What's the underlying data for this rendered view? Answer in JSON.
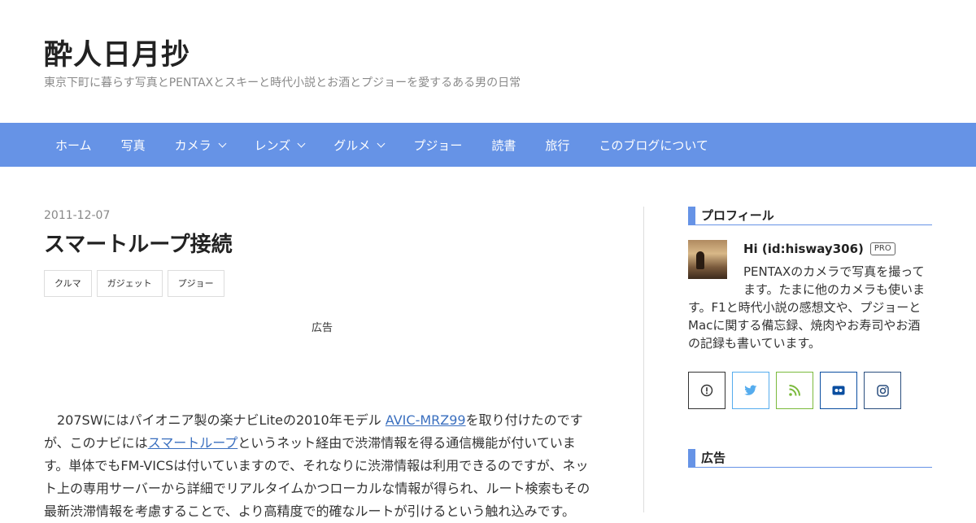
{
  "site": {
    "title": "酔人日月抄",
    "description": "東京下町に暮らす写真とPENTAXとスキーと時代小説とお酒とプジョーを愛するある男の日常"
  },
  "nav": {
    "items": [
      {
        "label": "ホーム",
        "dropdown": false
      },
      {
        "label": "写真",
        "dropdown": false
      },
      {
        "label": "カメラ",
        "dropdown": true
      },
      {
        "label": "レンズ",
        "dropdown": true
      },
      {
        "label": "グルメ",
        "dropdown": true
      },
      {
        "label": "プジョー",
        "dropdown": false
      },
      {
        "label": "読書",
        "dropdown": false
      },
      {
        "label": "旅行",
        "dropdown": false
      },
      {
        "label": "このブログについて",
        "dropdown": false
      }
    ],
    "color": "#6693e6"
  },
  "entry": {
    "date": "2011-12-07",
    "title": "スマートループ接続",
    "categories": [
      "クルマ",
      "ガジェット",
      "プジョー"
    ],
    "ad_label": "広告",
    "body": {
      "seg1": "207SWにはパイオニア製の楽ナビLiteの2010年モデル ",
      "link1": "AVIC-MRZ99",
      "seg2": "を取り付けたのですが、このナビには",
      "link2": "スマートループ",
      "seg3": "というネット経由で渋滞情報を得る通信機能が付いています。単体でもFM-VICSは付いていますので、それなりに渋滞情報は利用できるのですが、ネット上の専用サーバーから詳細でリアルタイムかつローカルな情報が得られ、ルート検索もその最新渋滞情報を考慮することで、より高精度で的確なルートが引けるという触れ込みです。"
    }
  },
  "sidebar": {
    "profile": {
      "title": "プロフィール",
      "name": "Hi (id:hisway306)",
      "badge": "PRO",
      "text_line1": "PENTAXのカメラで写真を撮って",
      "text_line2": "ます。たまに他のカメラも使いま",
      "text_rest": "す。F1と時代小説の感想文や、プジョーとMacに関する備忘録、焼肉やお寿司やお酒の記録も書いています。"
    },
    "social": [
      {
        "name": "hatena-icon",
        "color": "#333333"
      },
      {
        "name": "twitter-icon",
        "color": "#55acee"
      },
      {
        "name": "rss-icon",
        "color": "#7bba3c"
      },
      {
        "name": "flickr-icon",
        "color": "#0a4ea0"
      },
      {
        "name": "instagram-icon",
        "color": "#2a4e7e"
      }
    ],
    "ad_title": "広告"
  }
}
